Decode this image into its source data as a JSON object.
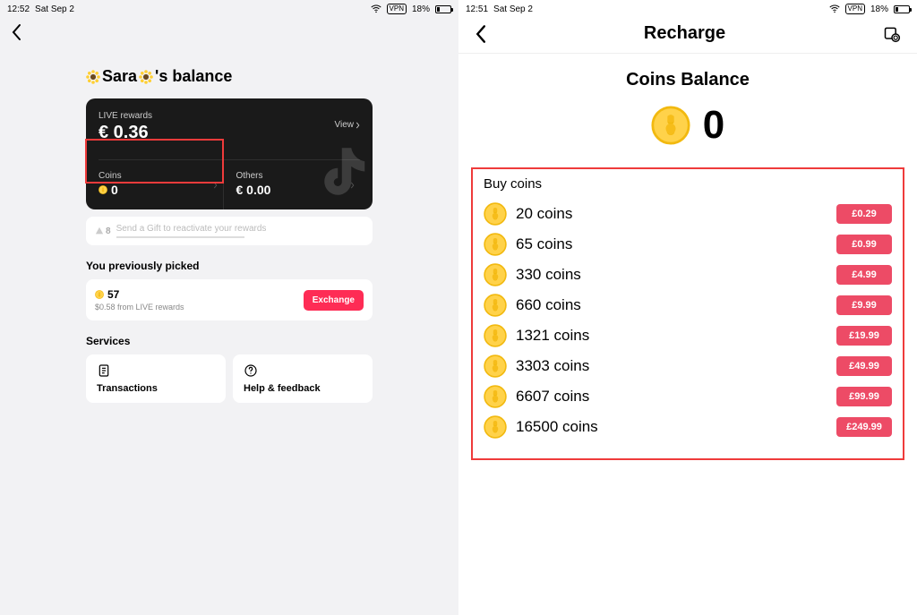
{
  "left": {
    "status": {
      "time": "12:52",
      "date": "Sat Sep 2",
      "vpn": "VPN",
      "battery_pct": "18%"
    },
    "title_name": "Sara",
    "title_suffix": "'s balance",
    "live_rewards_label": "LIVE rewards",
    "live_rewards_amount": "€ 0.36",
    "view_label": "View",
    "coins_label": "Coins",
    "coins_value": "0",
    "others_label": "Others",
    "others_value": "€ 0.00",
    "gift_count": "8",
    "gift_msg": "Send a Gift to reactivate your rewards",
    "picked_title": "You previously picked",
    "picked_amount": "57",
    "picked_sub": "$0.58 from LIVE rewards",
    "exchange_label": "Exchange",
    "services_title": "Services",
    "service_transactions": "Transactions",
    "service_help": "Help & feedback"
  },
  "right": {
    "status": {
      "time": "12:51",
      "date": "Sat Sep 2",
      "vpn": "VPN",
      "battery_pct": "18%"
    },
    "header_title": "Recharge",
    "coins_balance_title": "Coins Balance",
    "coins_balance_value": "0",
    "buy_title": "Buy coins",
    "offers": [
      {
        "label": "20 coins",
        "price": "£0.29"
      },
      {
        "label": "65 coins",
        "price": "£0.99"
      },
      {
        "label": "330 coins",
        "price": "£4.99"
      },
      {
        "label": "660 coins",
        "price": "£9.99"
      },
      {
        "label": "1321 coins",
        "price": "£19.99"
      },
      {
        "label": "3303 coins",
        "price": "£49.99"
      },
      {
        "label": "6607 coins",
        "price": "£99.99"
      },
      {
        "label": "16500 coins",
        "price": "£249.99"
      }
    ]
  }
}
